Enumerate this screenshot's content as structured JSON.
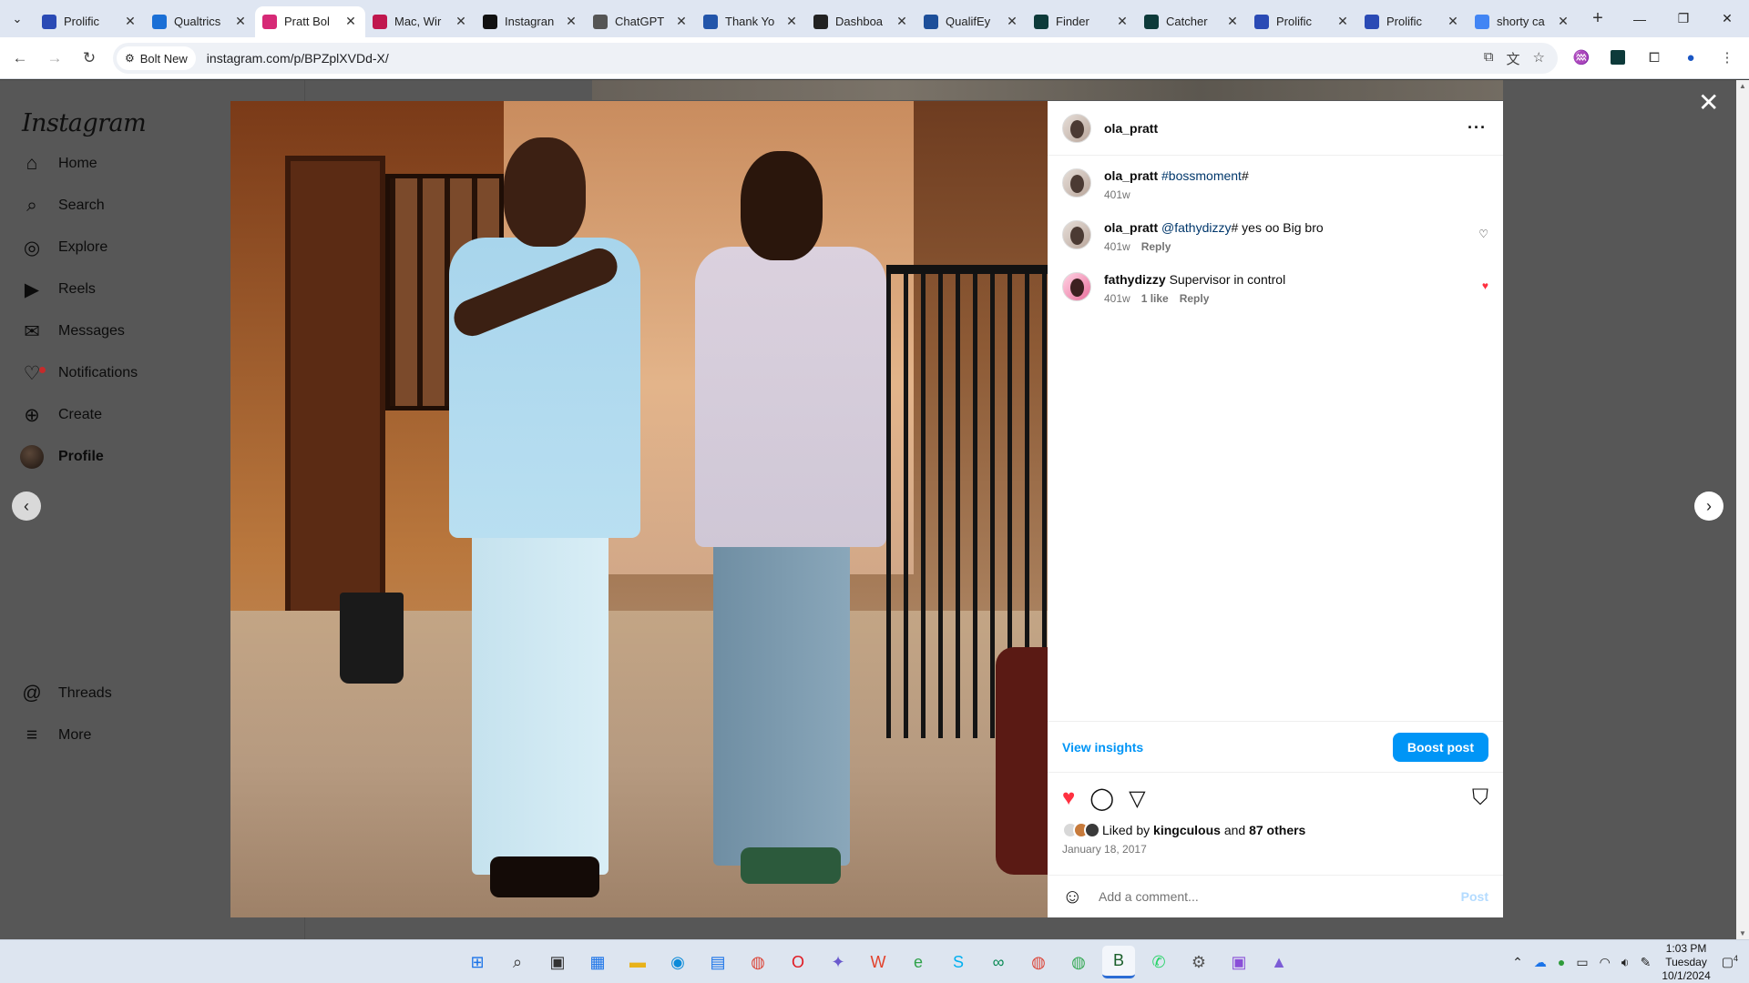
{
  "browser": {
    "tabs": [
      {
        "label": "Prolific",
        "favicon": "prolific-icon",
        "color": "#2a4ab5",
        "active": false
      },
      {
        "label": "Qualtrics",
        "favicon": "qualtrics-icon",
        "color": "#1a6fd6",
        "active": false
      },
      {
        "label": "Pratt Bol",
        "favicon": "instagram-icon",
        "color": "#d62976",
        "active": true
      },
      {
        "label": "Mac, Wir",
        "favicon": "p-icon",
        "color": "#c0174e",
        "active": false
      },
      {
        "label": "Instagran",
        "favicon": "m-icon",
        "color": "#111111",
        "active": false
      },
      {
        "label": "ChatGPT",
        "favicon": "chatgpt-icon",
        "color": "#555555",
        "active": false
      },
      {
        "label": "Thank Yo",
        "favicon": "thankyou-icon",
        "color": "#2255aa",
        "active": false
      },
      {
        "label": "Dashboa",
        "favicon": "amazon-icon",
        "color": "#222222",
        "active": false
      },
      {
        "label": "QualifEy",
        "favicon": "qualifeye-icon",
        "color": "#1d4f9a",
        "active": false
      },
      {
        "label": "Finder",
        "favicon": "mts-icon",
        "color": "#0d3a3a",
        "active": false
      },
      {
        "label": "Catcher",
        "favicon": "mts-icon",
        "color": "#0d3a3a",
        "active": false
      },
      {
        "label": "Prolific",
        "favicon": "prolific-icon",
        "color": "#2a4ab5",
        "active": false
      },
      {
        "label": "Prolific",
        "favicon": "prolific-icon",
        "color": "#2a4ab5",
        "active": false
      },
      {
        "label": "shorty ca",
        "favicon": "google-icon",
        "color": "#4285f4",
        "active": false
      }
    ],
    "address_chip": "Bolt New",
    "url": "instagram.com/p/BPZplXVDd-X/"
  },
  "instagram": {
    "logo": "Instagram",
    "nav": [
      {
        "label": "Home",
        "icon": "home-icon"
      },
      {
        "label": "Search",
        "icon": "search-icon"
      },
      {
        "label": "Explore",
        "icon": "explore-icon"
      },
      {
        "label": "Reels",
        "icon": "reels-icon"
      },
      {
        "label": "Messages",
        "icon": "messages-icon"
      },
      {
        "label": "Notifications",
        "icon": "heart-icon"
      },
      {
        "label": "Create",
        "icon": "plus-icon"
      },
      {
        "label": "Profile",
        "icon": "profile-avatar"
      }
    ],
    "nav_bottom": [
      {
        "label": "Threads",
        "icon": "threads-icon"
      },
      {
        "label": "More",
        "icon": "menu-icon"
      }
    ],
    "post": {
      "author": "ola_pratt",
      "comments": [
        {
          "user": "ola_pratt",
          "mention": "#bossmoment",
          "text": "#",
          "time": "401w",
          "likes": "",
          "reply": "",
          "liked": false,
          "has_heart": false
        },
        {
          "user": "ola_pratt",
          "mention": "@fathydizzy",
          "text": "# yes oo Big bro",
          "time": "401w",
          "likes": "",
          "reply": "Reply",
          "liked": false,
          "has_heart": true
        },
        {
          "user": "fathydizzy",
          "mention": "",
          "text": "Supervisor in control",
          "time": "401w",
          "likes": "1 like",
          "reply": "Reply",
          "liked": true,
          "has_heart": true
        }
      ],
      "view_insights": "View insights",
      "boost_post": "Boost post",
      "liked_by_prefix": "Liked by",
      "liked_by_user": "kingculous",
      "liked_by_and": "and",
      "liked_by_others": "87 others",
      "date": "January 18, 2017",
      "comment_placeholder": "Add a comment...",
      "post_label": "Post"
    }
  },
  "taskbar": {
    "time": "1:03 PM",
    "day": "Tuesday",
    "date": "10/1/2024",
    "notification_count": "4"
  },
  "colors": {
    "accent_blue": "#0095f6",
    "like_red": "#ff3040"
  }
}
